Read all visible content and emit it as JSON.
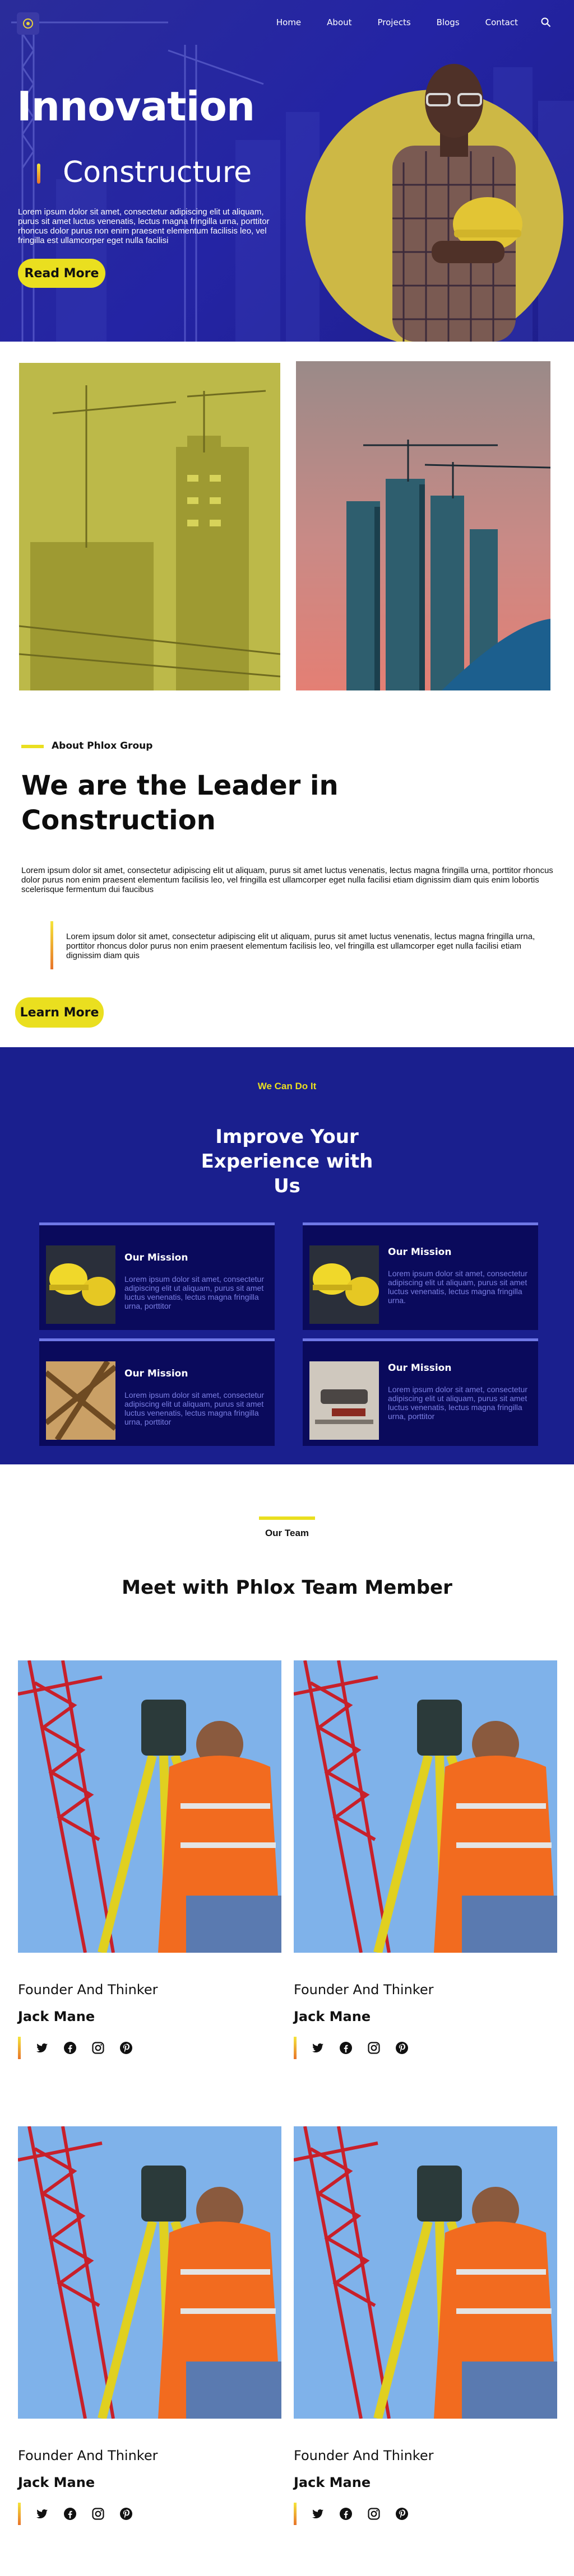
{
  "nav": {
    "items": [
      {
        "label": "Home"
      },
      {
        "label": "About"
      },
      {
        "label": "Projects"
      },
      {
        "label": "Blogs"
      },
      {
        "label": "Contact"
      }
    ]
  },
  "hero": {
    "title": "Innovation",
    "subtitle": "Constructure",
    "text": "Lorem ipsum dolor sit amet, consectetur adipiscing elit ut aliquam, purus sit amet luctus venenatis, lectus magna fringilla urna, porttitor rhoncus dolor purus non enim praesent elementum facilisis leo, vel fringilla est ullamcorper eget nulla facilisi",
    "button": "Read More"
  },
  "about": {
    "label": "About Phlox Group",
    "title": "We are the Leader in Construction",
    "text": "Lorem ipsum dolor sit amet, consectetur adipiscing elit ut aliquam, purus sit amet luctus venenatis, lectus magna fringilla urna, porttitor rhoncus dolor purus non enim praesent elementum facilisis leo, vel fringilla est ullamcorper eget nulla facilisi etiam dignissim diam quis enim lobortis scelerisque fermentum dui faucibus",
    "quote": "Lorem ipsum dolor sit amet, consectetur adipiscing elit ut aliquam, purus sit amet luctus venenatis, lectus magna fringilla urna, porttitor rhoncus dolor purus non enim praesent elementum facilisis leo, vel fringilla est ullamcorper eget nulla facilisi etiam dignissim diam quis",
    "button": "Learn More"
  },
  "services": {
    "kicker": "We Can Do It",
    "title": "Improve Your Experience with Us",
    "cards": [
      {
        "title": "Our Mission",
        "text": "Lorem ipsum dolor sit amet, consectetur adipiscing elit ut aliquam, purus sit amet luctus venenatis, lectus magna fringilla urna, porttitor",
        "thumb": "hard-hats"
      },
      {
        "title": "Our Mission",
        "text": "Lorem ipsum dolor sit amet, consectetur adipiscing elit ut aliquam, purus sit amet luctus venenatis, lectus magna fringilla urna.",
        "thumb": "hard-hats"
      },
      {
        "title": "Our Mission",
        "text": "Lorem ipsum dolor sit amet, consectetur adipiscing elit ut aliquam, purus sit amet luctus venenatis, lectus magna fringilla urna, porttitor",
        "thumb": "wood-beams"
      },
      {
        "title": "Our Mission",
        "text": "Lorem ipsum dolor sit amet, consectetur adipiscing elit ut aliquam, purus sit amet luctus venenatis, lectus magna fringilla urna, porttitor",
        "thumb": "tools"
      }
    ]
  },
  "team": {
    "label": "Our Team",
    "title": "Meet with Phlox Team Member",
    "members": [
      {
        "role": "Founder And Thinker",
        "name": "Jack Mane"
      },
      {
        "role": "Founder And Thinker",
        "name": "Jack Mane"
      },
      {
        "role": "Founder And Thinker",
        "name": "Jack Mane"
      },
      {
        "role": "Founder And Thinker",
        "name": "Jack Mane"
      }
    ],
    "socials": [
      "twitter-icon",
      "facebook-icon",
      "instagram-icon",
      "pinterest-icon"
    ]
  },
  "colors": {
    "accent_yellow": "#eadf1f",
    "brand_blue": "#2424a4",
    "services_bg": "#1a1f8e",
    "card_bg": "#0a0a5c"
  }
}
